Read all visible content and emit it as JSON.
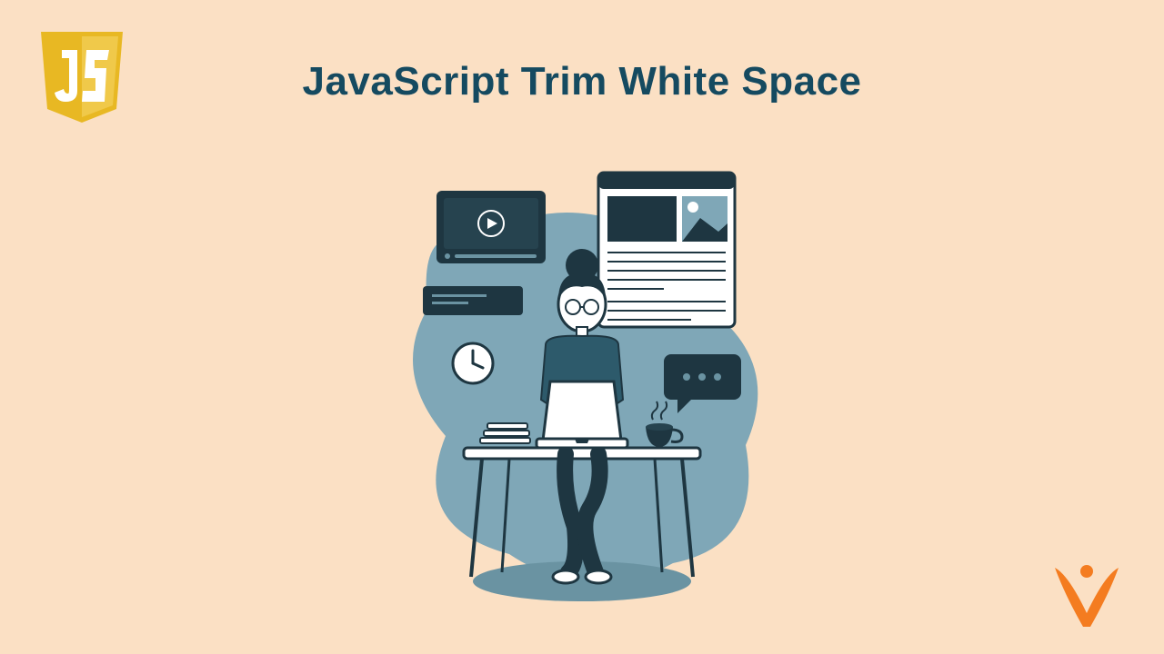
{
  "title": "JavaScript Trim White Space",
  "logo_text": "JS",
  "colors": {
    "bg": "#fbe0c4",
    "title": "#154a60",
    "js_yellow": "#e8b823",
    "brand_orange": "#f47c20",
    "illus_dark": "#1e3641",
    "illus_blue": "#7fa7b7",
    "illus_light": "#ffffff"
  }
}
